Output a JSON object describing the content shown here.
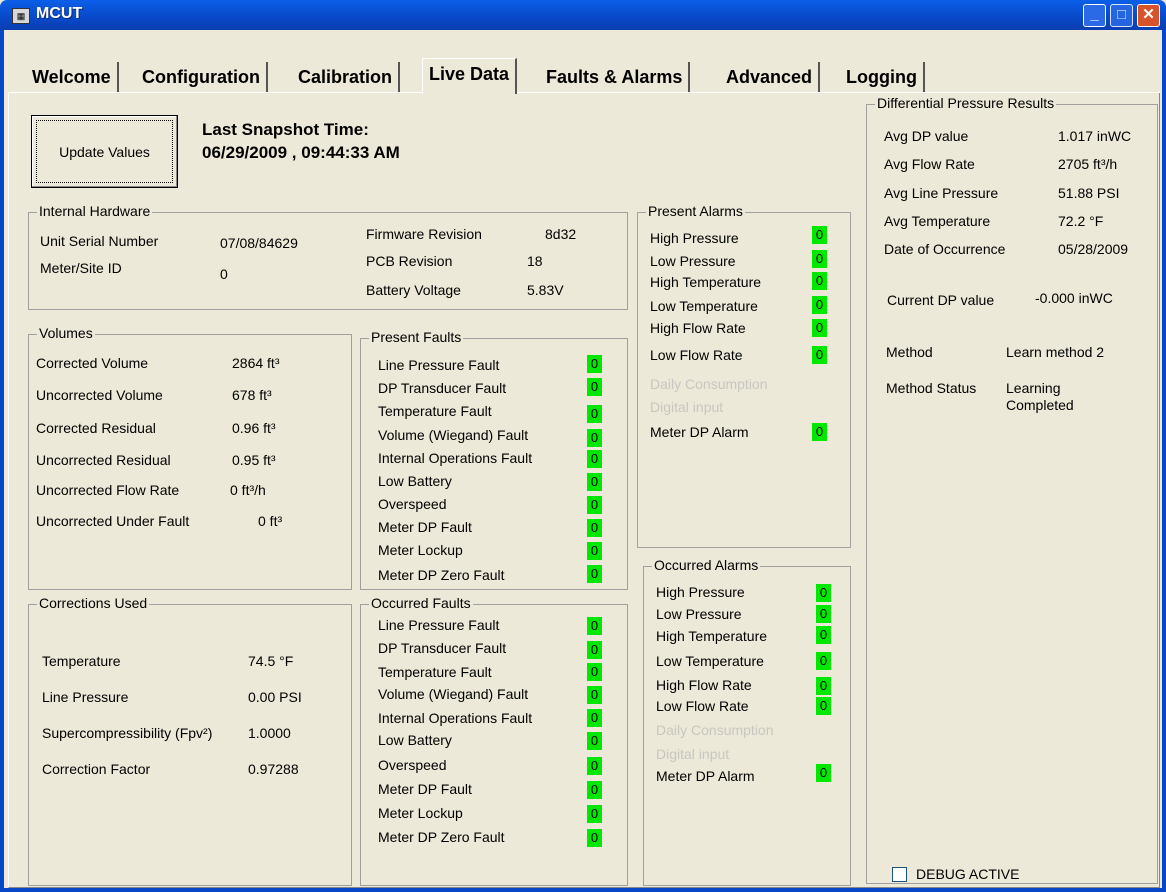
{
  "window": {
    "title": "MCUT",
    "icon": "app-icon"
  },
  "tabs": [
    "Welcome",
    "Configuration",
    "Calibration",
    "Live Data",
    "Faults & Alarms",
    "Advanced",
    "Logging"
  ],
  "active_tab": "Live Data",
  "update": {
    "label": "Update Values",
    "snapshot_label": "Last Snapshot Time:",
    "snapshot_value": "06/29/2009 , 09:44:33 AM"
  },
  "internal_hardware": {
    "title": "Internal Hardware",
    "serial_label": "Unit Serial Number",
    "serial_value": "07/08/84629",
    "meter_label": "Meter/Site ID",
    "meter_value": "0",
    "firmware_label": "Firmware Revision",
    "firmware_value": "8d32",
    "pcb_label": "PCB Revision",
    "pcb_value": "18",
    "battery_label": "Battery Voltage",
    "battery_value": "5.83V"
  },
  "volumes": {
    "title": "Volumes",
    "rows": [
      {
        "label": "Corrected Volume",
        "value": "2864 ft³"
      },
      {
        "label": "Uncorrected Volume",
        "value": "678 ft³"
      },
      {
        "label": "Corrected Residual",
        "value": "0.96 ft³"
      },
      {
        "label": "Uncorrected Residual",
        "value": "0.95 ft³"
      },
      {
        "label": "Uncorrected Flow Rate",
        "value": "0 ft³/h"
      },
      {
        "label": "Uncorrected Under Fault",
        "value": "0 ft³"
      }
    ]
  },
  "corrections": {
    "title": "Corrections Used",
    "rows": [
      {
        "label": "Temperature",
        "value": "74.5 °F"
      },
      {
        "label": "Line Pressure",
        "value": "0.00 PSI"
      },
      {
        "label": "Supercompressibility (Fpv²)",
        "value": "1.0000"
      },
      {
        "label": "Correction Factor",
        "value": "0.97288"
      }
    ]
  },
  "present_faults": {
    "title": "Present Faults",
    "rows": [
      {
        "label": "Line Pressure Fault",
        "value": "0"
      },
      {
        "label": "DP Transducer Fault",
        "value": "0"
      },
      {
        "label": "Temperature Fault",
        "value": "0"
      },
      {
        "label": "Volume (Wiegand) Fault",
        "value": "0"
      },
      {
        "label": "Internal Operations Fault",
        "value": "0"
      },
      {
        "label": "Low Battery",
        "value": "0"
      },
      {
        "label": "Overspeed",
        "value": "0"
      },
      {
        "label": "Meter DP Fault",
        "value": "0"
      },
      {
        "label": "Meter Lockup",
        "value": "0"
      },
      {
        "label": "Meter DP Zero Fault",
        "value": "0"
      }
    ]
  },
  "occurred_faults": {
    "title": "Occurred Faults",
    "rows": [
      {
        "label": "Line Pressure Fault",
        "value": "0"
      },
      {
        "label": "DP Transducer Fault",
        "value": "0"
      },
      {
        "label": "Temperature Fault",
        "value": "0"
      },
      {
        "label": "Volume (Wiegand) Fault",
        "value": "0"
      },
      {
        "label": "Internal Operations Fault",
        "value": "0"
      },
      {
        "label": "Low Battery",
        "value": "0"
      },
      {
        "label": "Overspeed",
        "value": "0"
      },
      {
        "label": "Meter DP Fault",
        "value": "0"
      },
      {
        "label": "Meter Lockup",
        "value": "0"
      },
      {
        "label": "Meter DP Zero Fault",
        "value": "0"
      }
    ]
  },
  "present_alarms": {
    "title": "Present Alarms",
    "rows": [
      {
        "label": "High Pressure",
        "value": "0"
      },
      {
        "label": "Low Pressure",
        "value": "0"
      },
      {
        "label": "High Temperature",
        "value": "0"
      },
      {
        "label": "Low Temperature",
        "value": "0"
      },
      {
        "label": "High Flow Rate",
        "value": "0"
      },
      {
        "label": "Low Flow Rate",
        "value": "0"
      }
    ],
    "daily": "Daily Consumption",
    "digital": "Digital input",
    "meter_dp_label": "Meter DP Alarm",
    "meter_dp_value": "0"
  },
  "occurred_alarms": {
    "title": "Occurred Alarms",
    "rows": [
      {
        "label": "High Pressure",
        "value": "0"
      },
      {
        "label": "Low Pressure",
        "value": "0"
      },
      {
        "label": "High Temperature",
        "value": "0"
      },
      {
        "label": "Low Temperature",
        "value": "0"
      },
      {
        "label": "High Flow Rate",
        "value": "0"
      },
      {
        "label": "Low Flow Rate",
        "value": "0"
      }
    ],
    "daily": "Daily Consumption",
    "digital": "Digital input",
    "meter_dp_label": "Meter DP Alarm",
    "meter_dp_value": "0"
  },
  "dp_results": {
    "title": "Differential Pressure Results",
    "rows": [
      {
        "label": "Avg DP value",
        "value": "1.017 inWC"
      },
      {
        "label": "Avg Flow Rate",
        "value": "2705 ft³/h"
      },
      {
        "label": "Avg Line Pressure",
        "value": "51.88 PSI"
      },
      {
        "label": "Avg Temperature",
        "value": "72.2 °F"
      },
      {
        "label": "Date of Occurrence",
        "value": "05/28/2009"
      }
    ],
    "current_dp_label": "Current DP value",
    "current_dp_value": "-0.000 inWC",
    "method_label": "Method",
    "method_value": "Learn method 2",
    "method_status_label": "Method Status",
    "method_status_line1": "Learning",
    "method_status_line2": "Completed"
  },
  "debug": {
    "label": "DEBUG ACTIVE",
    "checked": false
  },
  "colors": {
    "indicator": "#00e800",
    "titlebar": "#0848c8",
    "face": "#ece9d8"
  }
}
